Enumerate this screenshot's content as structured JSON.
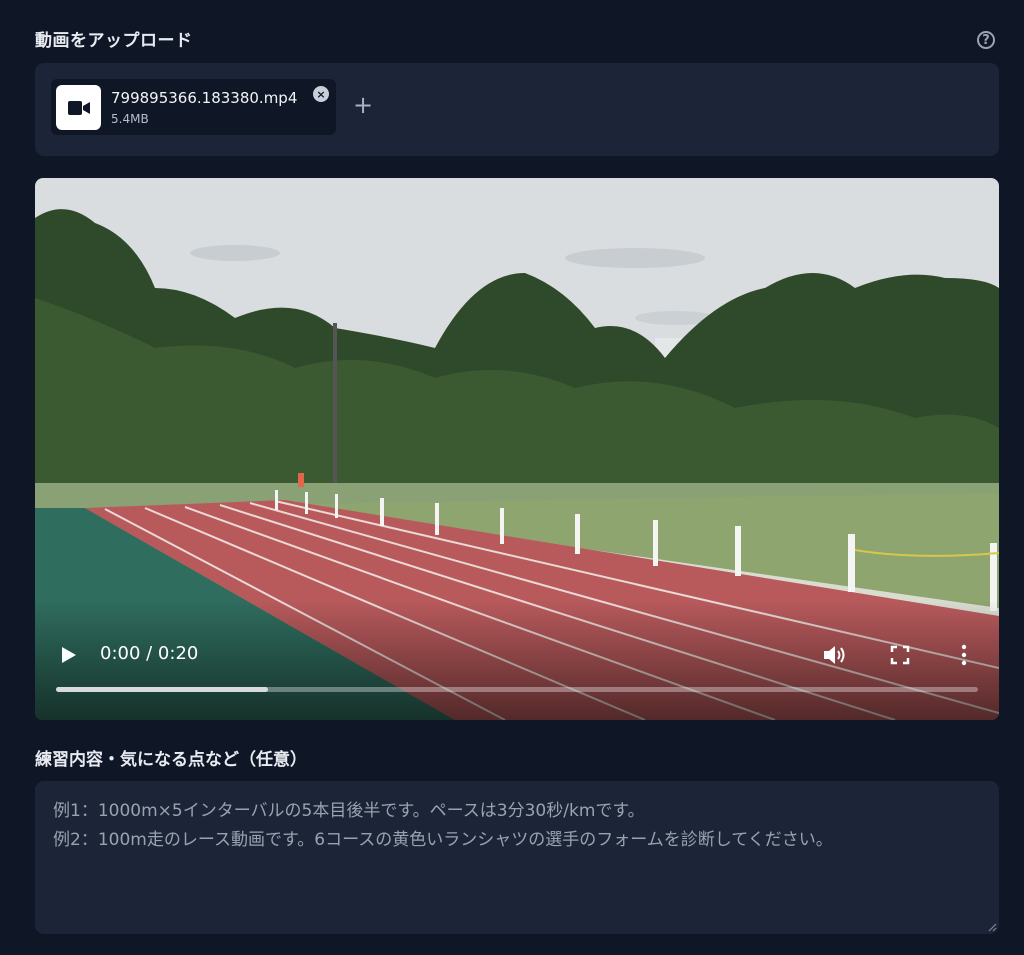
{
  "upload": {
    "title": "動画をアップロード",
    "help_glyph": "?",
    "file": {
      "name": "799895366.183380.mp4",
      "size": "5.4MB",
      "remove_glyph": "×",
      "icon": "video-camera-icon"
    },
    "add_glyph": "+"
  },
  "player": {
    "time": "0:00 / 0:20",
    "progress": 0.23,
    "icons": [
      "play-icon",
      "volume-icon",
      "fullscreen-icon",
      "more-options-icon"
    ]
  },
  "notes": {
    "label": "練習内容・気になる点など（任意）",
    "placeholder": "例1：1000m×5インターバルの5本目後半です。ペースは3分30秒/kmです。\n例2：100m走のレース動画です。6コースの黄色いランシャツの選手のフォームを診断してください。"
  },
  "colors": {
    "background": "#0f1626",
    "panel": "#1c2537",
    "track": "#b85a5c",
    "grass": "#7e9c63"
  }
}
